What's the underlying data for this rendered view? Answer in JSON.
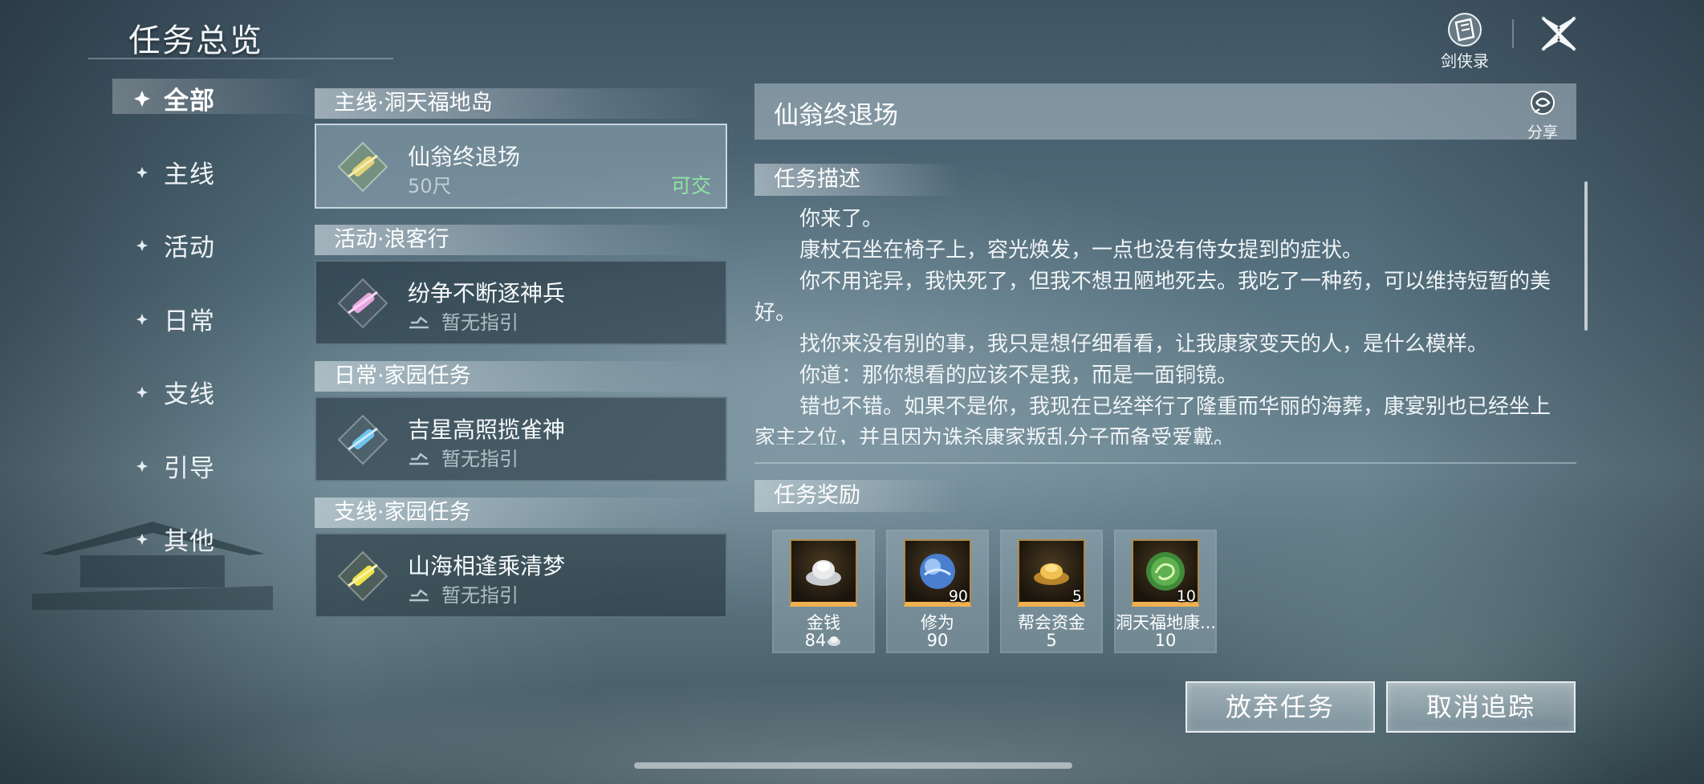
{
  "header": {
    "title": "任务总览",
    "codex_label": "剑侠录",
    "close_icon": "crossed-swords-close-icon"
  },
  "categories": [
    {
      "label": "全部",
      "active": true
    },
    {
      "label": "主线"
    },
    {
      "label": "活动"
    },
    {
      "label": "日常"
    },
    {
      "label": "支线"
    },
    {
      "label": "引导"
    },
    {
      "label": "其他"
    }
  ],
  "quest_groups": [
    {
      "header": "主线·洞天福地岛",
      "quest": {
        "name": "仙翁终退场",
        "sub": "50尺",
        "state": "可交",
        "icon_color": "#e3d27a",
        "selected": true
      }
    },
    {
      "header": "活动·浪客行",
      "quest": {
        "name": "纷争不断逐神兵",
        "sub": "暂无指引",
        "icon_color": "#e7a6e0"
      }
    },
    {
      "header": "日常·家园任务",
      "quest": {
        "name": "吉星高照揽雀神",
        "sub": "暂无指引",
        "icon_color": "#6cc3ef"
      }
    },
    {
      "header": "支线·家园任务",
      "quest": {
        "name": "山海相逢乘清梦",
        "sub": "暂无指引",
        "icon_color": "#f0e24a"
      }
    }
  ],
  "detail": {
    "title": "仙翁终退场",
    "share_label": "分享",
    "desc_header": "任务描述",
    "paragraphs": [
      "你来了。",
      "康杖石坐在椅子上，容光焕发，一点也没有侍女提到的症状。",
      "你不用诧异，我快死了，但我不想丑陋地死去。我吃了一种药，可以维持短暂的美好。",
      "找你来没有别的事，我只是想仔细看看，让我康家变天的人，是什么模样。",
      "你道：那你想看的应该不是我，而是一面铜镜。",
      "错也不错。如果不是你，我现在已经举行了隆重而华丽的海葬，康宴别也已经坐上家主之位，并且因为诛杀康家叛乱分子而备受爱戴。"
    ],
    "reward_header": "任务奖励",
    "rewards": [
      {
        "name": "金钱",
        "amount": "84",
        "qty": "",
        "icon": "silver-ingot-icon"
      },
      {
        "name": "修为",
        "amount": "90",
        "qty": "90",
        "icon": "blue-orb-icon"
      },
      {
        "name": "帮会资金",
        "amount": "5",
        "qty": "5",
        "icon": "gold-ingot-icon"
      },
      {
        "name": "洞天福地康...",
        "amount": "10",
        "qty": "10",
        "icon": "jade-dragon-icon"
      }
    ]
  },
  "actions": {
    "abandon": "放弃任务",
    "untrack": "取消追踪"
  },
  "colors": {
    "ready_state": "#8fe3a0",
    "reward_rim": "#f0b050"
  }
}
